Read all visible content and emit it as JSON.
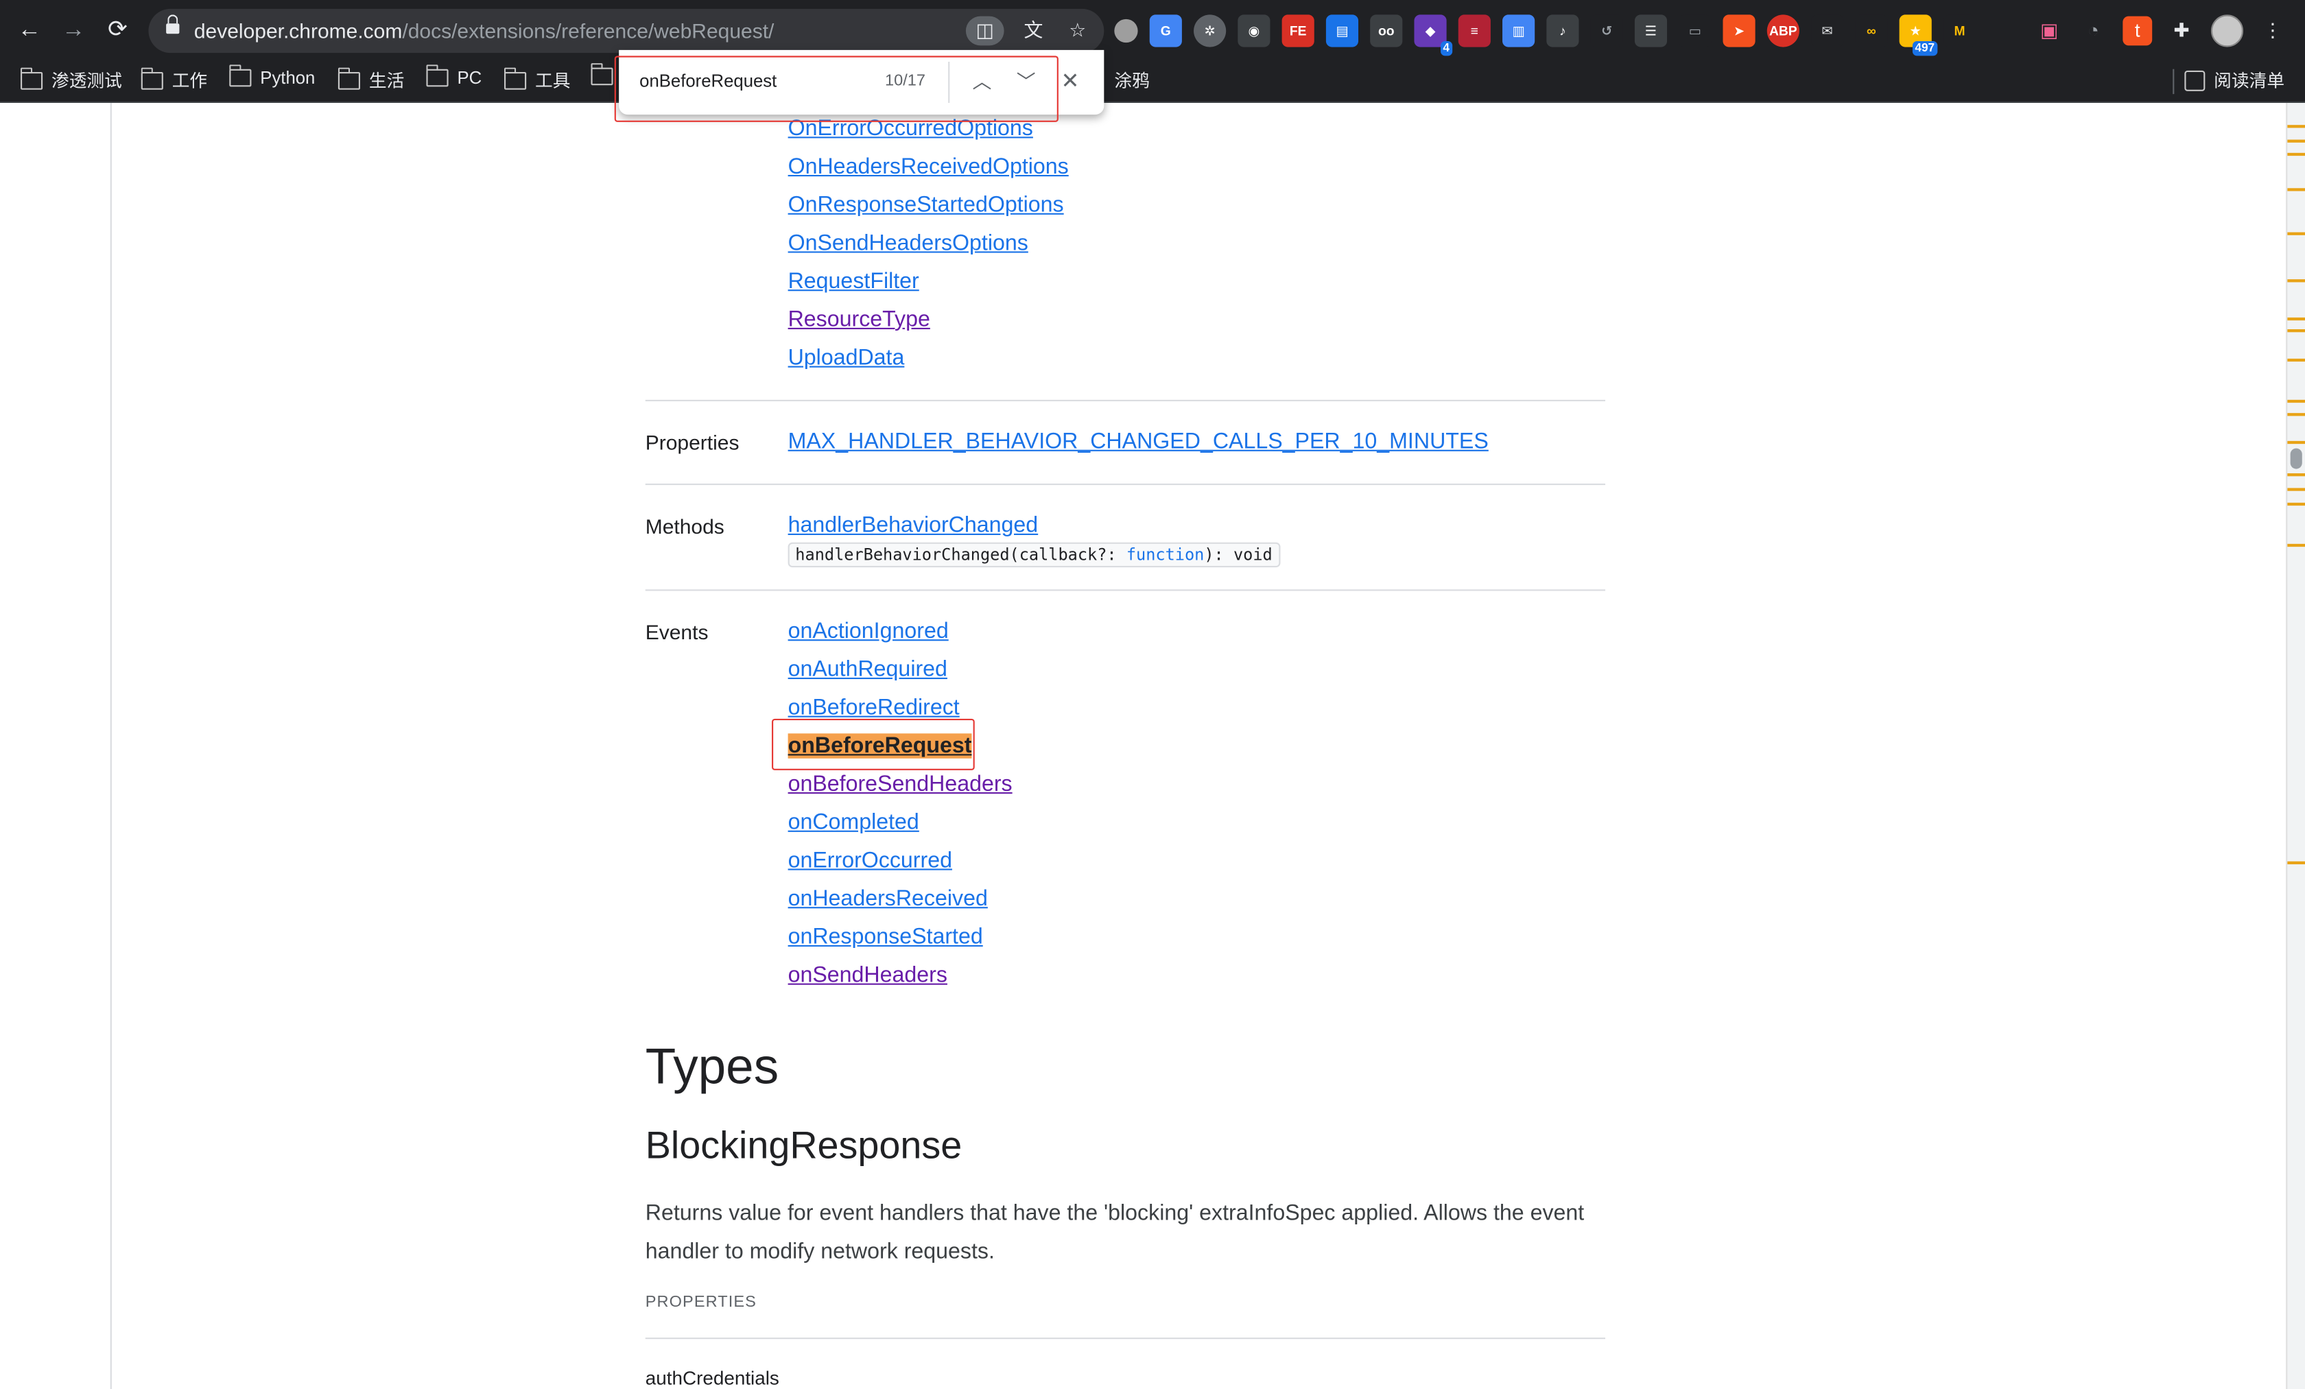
{
  "browser": {
    "url_host": "developer.chrome.com",
    "url_path": "/docs/extensions/reference/webRequest/",
    "bookmarks": [
      "渗透测试",
      "工作",
      "Python",
      "生活",
      "PC",
      "工具",
      "涂鸦"
    ],
    "reading_list_label": "阅读清单",
    "extension_badges": {
      "ext4_count": "4",
      "ext_news_count": "497"
    },
    "extension_labels": {
      "fe": "FE",
      "abp": "ABP"
    }
  },
  "find_bar": {
    "query": "onBeforeRequest",
    "count": "10/17"
  },
  "page": {
    "options_links": [
      "OnErrorOccurredOptions",
      "OnHeadersReceivedOptions",
      "OnResponseStartedOptions",
      "OnSendHeadersOptions",
      "RequestFilter",
      "ResourceType",
      "UploadData"
    ],
    "properties_label": "Properties",
    "properties_link": "MAX_HANDLER_BEHAVIOR_CHANGED_CALLS_PER_10_MINUTES",
    "methods_label": "Methods",
    "methods_link": "handlerBehaviorChanged",
    "method_signature_prefix": "handlerBehaviorChanged(callback?: ",
    "method_signature_kw": "function",
    "method_signature_suffix": "): void",
    "events_label": "Events",
    "events": [
      "onActionIgnored",
      "onAuthRequired",
      "onBeforeRedirect",
      "onBeforeRequest",
      "onBeforeSendHeaders",
      "onCompleted",
      "onErrorOccurred",
      "onHeadersReceived",
      "onResponseStarted",
      "onSendHeaders"
    ],
    "types_heading": "Types",
    "blocking_heading": "BlockingResponse",
    "blocking_desc": "Returns value for event handlers that have the 'blocking' extraInfoSpec applied. Allows the event handler to modify network requests.",
    "properties_caps": "PROPERTIES",
    "first_property": "authCredentials"
  },
  "colors": {
    "link": "#1a73e8",
    "visited": "#681da8",
    "highlight": "#f5a04c",
    "annotation": "#e53935"
  }
}
